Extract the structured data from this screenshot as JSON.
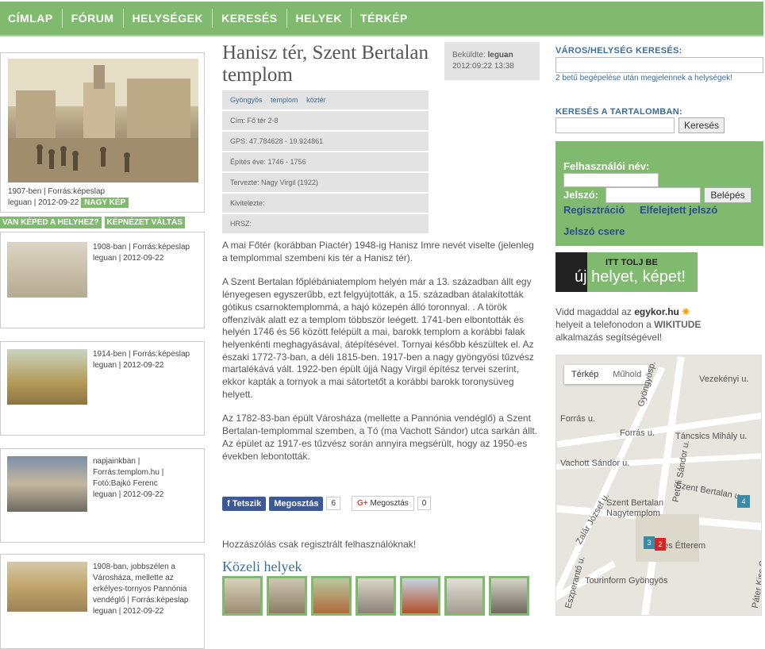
{
  "nav": [
    "CÍMLAP",
    "FÓRUM",
    "HELYSÉGEK",
    "KERESÉS",
    "HELYEK",
    "TÉRKÉP"
  ],
  "main_image": {
    "caption1": "1907-ben | Forrás:képeslap",
    "caption2": "leguan | 2012-09-22",
    "big_button": "NAGY KÉP"
  },
  "left_buttons": [
    "VAN KÉPED A HELYHEZ?",
    "KÉPNÉZET VÁLTÁS"
  ],
  "thumbs": [
    {
      "lines": [
        "1908-ban | Forrás:képeslap",
        "leguan | 2012-09-22"
      ]
    },
    {
      "lines": [
        "1914-ben | Forrás:képeslap",
        "leguan | 2012-09-22"
      ]
    },
    {
      "lines": [
        "napjainkban |",
        "Forrás:templom.hu |",
        "Fotó:Bajkó Ferenc",
        "leguan | 2012-09-22"
      ]
    },
    {
      "lines": [
        "1908-ban, jobbszélen a",
        "Városháza, mellette az",
        "erkélyes-tornyos Pannónia",
        "vendéglő | Forrás:képeslap",
        "leguan | 2012-09-22"
      ]
    }
  ],
  "title": "Hanisz tér, Szent Bertalan templom",
  "byline": {
    "label": "Beküldte:",
    "user": "leguan",
    "date": "2012:09:22 13:38"
  },
  "tags": [
    "Gyöngyös",
    "templom",
    "köztér"
  ],
  "meta": [
    "Cím: Fő tér 2-8",
    "GPS: 47.784628 - 19.924861",
    "Építés éve: 1746 - 1756",
    "Tervezte: Nagy Virgil (1922)",
    "Kivitelezte:",
    "HRSZ:"
  ],
  "body": [
    "A mai Főtér (korábban Piactér)  1948-ig Hanisz Imre nevét viselte (jelenleg a templommal szembeni kis tér a Hanisz tér).",
    "A Szent Bertalan főplébániatemplom helyén már a 13. században állt egy lényegesen egyszerűbb, ezt felgyújtották, a 15. században átalakították gótikus csarnoktemplommá, a hajó közepén álló toronnyal. . A török offenzívák alatt ez a templom többször leégett. 1741-ben elbontották és helyén 1746 és 56 között felépült a mai, barokk templom a korábbi falak helyenkénti meghagyásával, átépítésével. Tornyai később készültek el. Az északi 1772-73-ban, a déli 1815-ben. 1917-ben a nagy gyöngyösi tűzvész martalékává vált. 1922-ben épült újjá Nagy Virgil építész tervei szerint, ekkor kapták a tornyok a mai sátortetőt a korábbi barokk toronysüveg helyett.",
    "Az 1782-83-ban épült Városháza (mellette a Pannónia vendéglő) a Szent Bertalan-templommal szemben, a Tó (ma Vachott Sándor) utca sarkán állt. Az épület az 1917-es tűzvész során annyira megsérült, hogy az 1950-es években lebontották."
  ],
  "share": {
    "like": "Tetszik",
    "share": "Megosztás",
    "share_count": "6",
    "gplus": "Megosztás",
    "gplus_count": "0"
  },
  "comment_note": "Hozzászólás csak regisztrált felhasználóknak!",
  "near_title": "Közeli helyek",
  "search": {
    "city_label": "VÁROS/HELYSÉG KERESÉS:",
    "city_hint": "2 betű begépelése után megjelennek a helységek!",
    "content_label": "KERESÉS A TARTALOMBAN:",
    "search_button": "Keresés"
  },
  "login": {
    "user_label": "Felhasználói név:",
    "pass_label": "Jelszó:",
    "login_button": "Belépés",
    "register": "Regisztráció",
    "forgot": "Elfelejtett jelszó",
    "change": "Jelszó csere"
  },
  "banner": {
    "line1": "ITT TOLJ BE",
    "line2": "új helyet, képet!"
  },
  "app": {
    "pre": "Vidd magaddal az ",
    "brand": "egykor.hu",
    "mid": "helyeit a telefonodon a ",
    "brand2": "WIKITUDE",
    "post": "alkalmazás segítségével!"
  },
  "map": {
    "tabs": [
      "Térkép",
      "Műhold"
    ],
    "labels": [
      "Vezekényi u.",
      "Forrás u.",
      "Táncsics Mihály u.",
      "Forrás u.",
      "Vachott Sándor u.",
      "Szent Bertalan u.",
      "Szent Bertalan",
      "Nagytemplom",
      "Zalár József u.",
      "Petőfi Sándor u.",
      "Gyöngyösp.",
      "Tourinform Gyöngyös",
      "Páter Kiss Szaléz",
      "Eszperantó u.",
      "es Étterem"
    ],
    "markers": [
      "4",
      "3",
      "2"
    ]
  }
}
